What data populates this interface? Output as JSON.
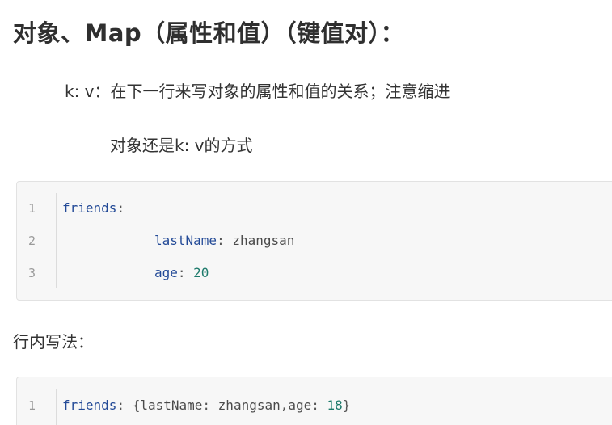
{
  "heading": "对象、Map（属性和值）（键值对）：",
  "para1": "k: v：在下一行来写对象的属性和值的关系；注意缩进",
  "para2": "对象还是k: v的方式",
  "para3": "行内写法：",
  "code_block_1": {
    "lines": [
      {
        "no": "1",
        "key": "friends",
        "colon": ":",
        "value": ""
      },
      {
        "no": "2",
        "key": "lastName",
        "colon": ": ",
        "value": "zhangsan"
      },
      {
        "no": "3",
        "key": "age",
        "colon": ": ",
        "value": "20"
      }
    ]
  },
  "code_block_2": {
    "lines": [
      {
        "no": "1",
        "key": "friends",
        "colon": ": ",
        "open": "{",
        "k1": "lastName",
        "s1": ": ",
        "v1": "zhangsan",
        "comma": ",",
        "k2": "age",
        "s2": ": ",
        "v2": "18",
        "close": "}"
      }
    ]
  }
}
